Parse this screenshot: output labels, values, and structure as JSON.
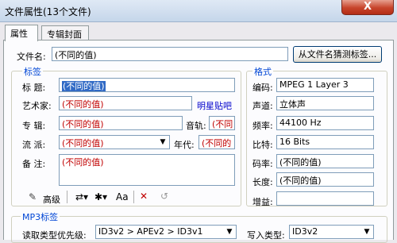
{
  "window": {
    "title": "文件属性(13个文件)",
    "close_glyph": "X"
  },
  "tabs": [
    "属性",
    "专辑封面"
  ],
  "filename": {
    "label": "文件名:",
    "value": "(不同的值)",
    "guess_button": "从文件名猜测标签..."
  },
  "tags_group": {
    "legend": "标签",
    "title_label": "标  题:",
    "title_value": "(不同的值)",
    "artist_label": "艺术家:",
    "artist_value": "(不同的值)",
    "artist_link": "明星贴吧",
    "album_label": "专  辑:",
    "album_value": "(不同的值)",
    "track_label": "音轨:",
    "track_value": "(不同",
    "genre_label": "流  派:",
    "genre_value": "(不同的值)",
    "year_label": "年代:",
    "year_value": "(不同的",
    "comment_label": "备  注:",
    "comment_value": "(不同的值)",
    "advanced_label": "高级"
  },
  "format_group": {
    "legend": "格式",
    "rows": [
      {
        "label": "编码:",
        "value": "MPEG 1 Layer 3"
      },
      {
        "label": "声道:",
        "value": "立体声"
      },
      {
        "label": "频率:",
        "value": "44100 Hz"
      },
      {
        "label": "比特:",
        "value": "16 Bits"
      },
      {
        "label": "码率:",
        "value": "(不同的值)"
      },
      {
        "label": "长度:",
        "value": "(不同的值)"
      },
      {
        "label": "增益:",
        "value": ""
      }
    ]
  },
  "mp3_group": {
    "legend": "MP3标签",
    "read_priority_label": "读取类型优先级:",
    "read_priority_value": "ID3v2 > APEv2 > ID3v1",
    "write_type_label": "写入类型:",
    "write_type_value": "ID3v2"
  }
}
